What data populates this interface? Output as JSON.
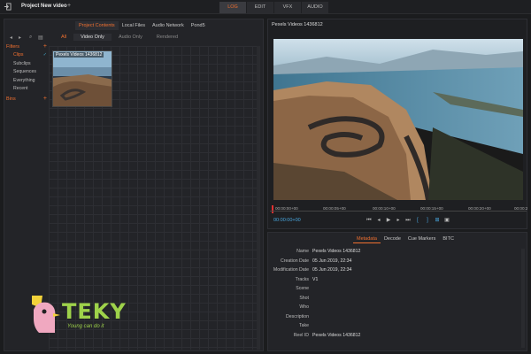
{
  "header": {
    "project_title": "Project New video",
    "add_symbol": "+",
    "mode_tabs": [
      "LOG",
      "EDIT",
      "VFX",
      "AUDIO"
    ]
  },
  "browser": {
    "tabs": [
      "Project Contents",
      "Local Files",
      "Audio Network",
      "Pond5"
    ],
    "filter_tabs": [
      "All",
      "Video Only",
      "Audio Only",
      "Rendered"
    ],
    "sidebar": {
      "filters_label": "Filters",
      "items": [
        "Clips",
        "Subclips",
        "Sequences",
        "Everything",
        "Recent"
      ],
      "bins_label": "Bins"
    },
    "clip": {
      "label": "Pexels Videos 1436812"
    }
  },
  "viewer": {
    "title": "Pexels Videos 1436812",
    "timecodes": [
      "00:00:00+00",
      "00:00:05+00",
      "00:00:10+00",
      "00:00:15+00",
      "00:00:20+00",
      "00:00:2"
    ],
    "current_tc": "00:00:00+00"
  },
  "metadata": {
    "tabs": [
      "Metadata",
      "Decode",
      "Cue Markers",
      "BITC"
    ],
    "rows": [
      {
        "key": "Name",
        "value": "Pexels Videos 1436812"
      },
      {
        "key": "Creation Date",
        "value": "05 Jun 2019, 22:34"
      },
      {
        "key": "Modification Date",
        "value": "05 Jun 2019, 22:34"
      },
      {
        "key": "Tracks",
        "value": "V1"
      },
      {
        "key": "Scene",
        "value": ""
      },
      {
        "key": "Shot",
        "value": ""
      },
      {
        "key": "Who",
        "value": ""
      },
      {
        "key": "Description",
        "value": ""
      },
      {
        "key": "Take",
        "value": ""
      },
      {
        "key": "Reel ID",
        "value": "Pexels Videos 1436812"
      }
    ]
  },
  "watermark": {
    "brand": "TEKY",
    "tagline": "Young can do it"
  },
  "colors": {
    "accent": "#f07030",
    "timecode": "#4aa8e0",
    "logo": "#9ed24a"
  }
}
